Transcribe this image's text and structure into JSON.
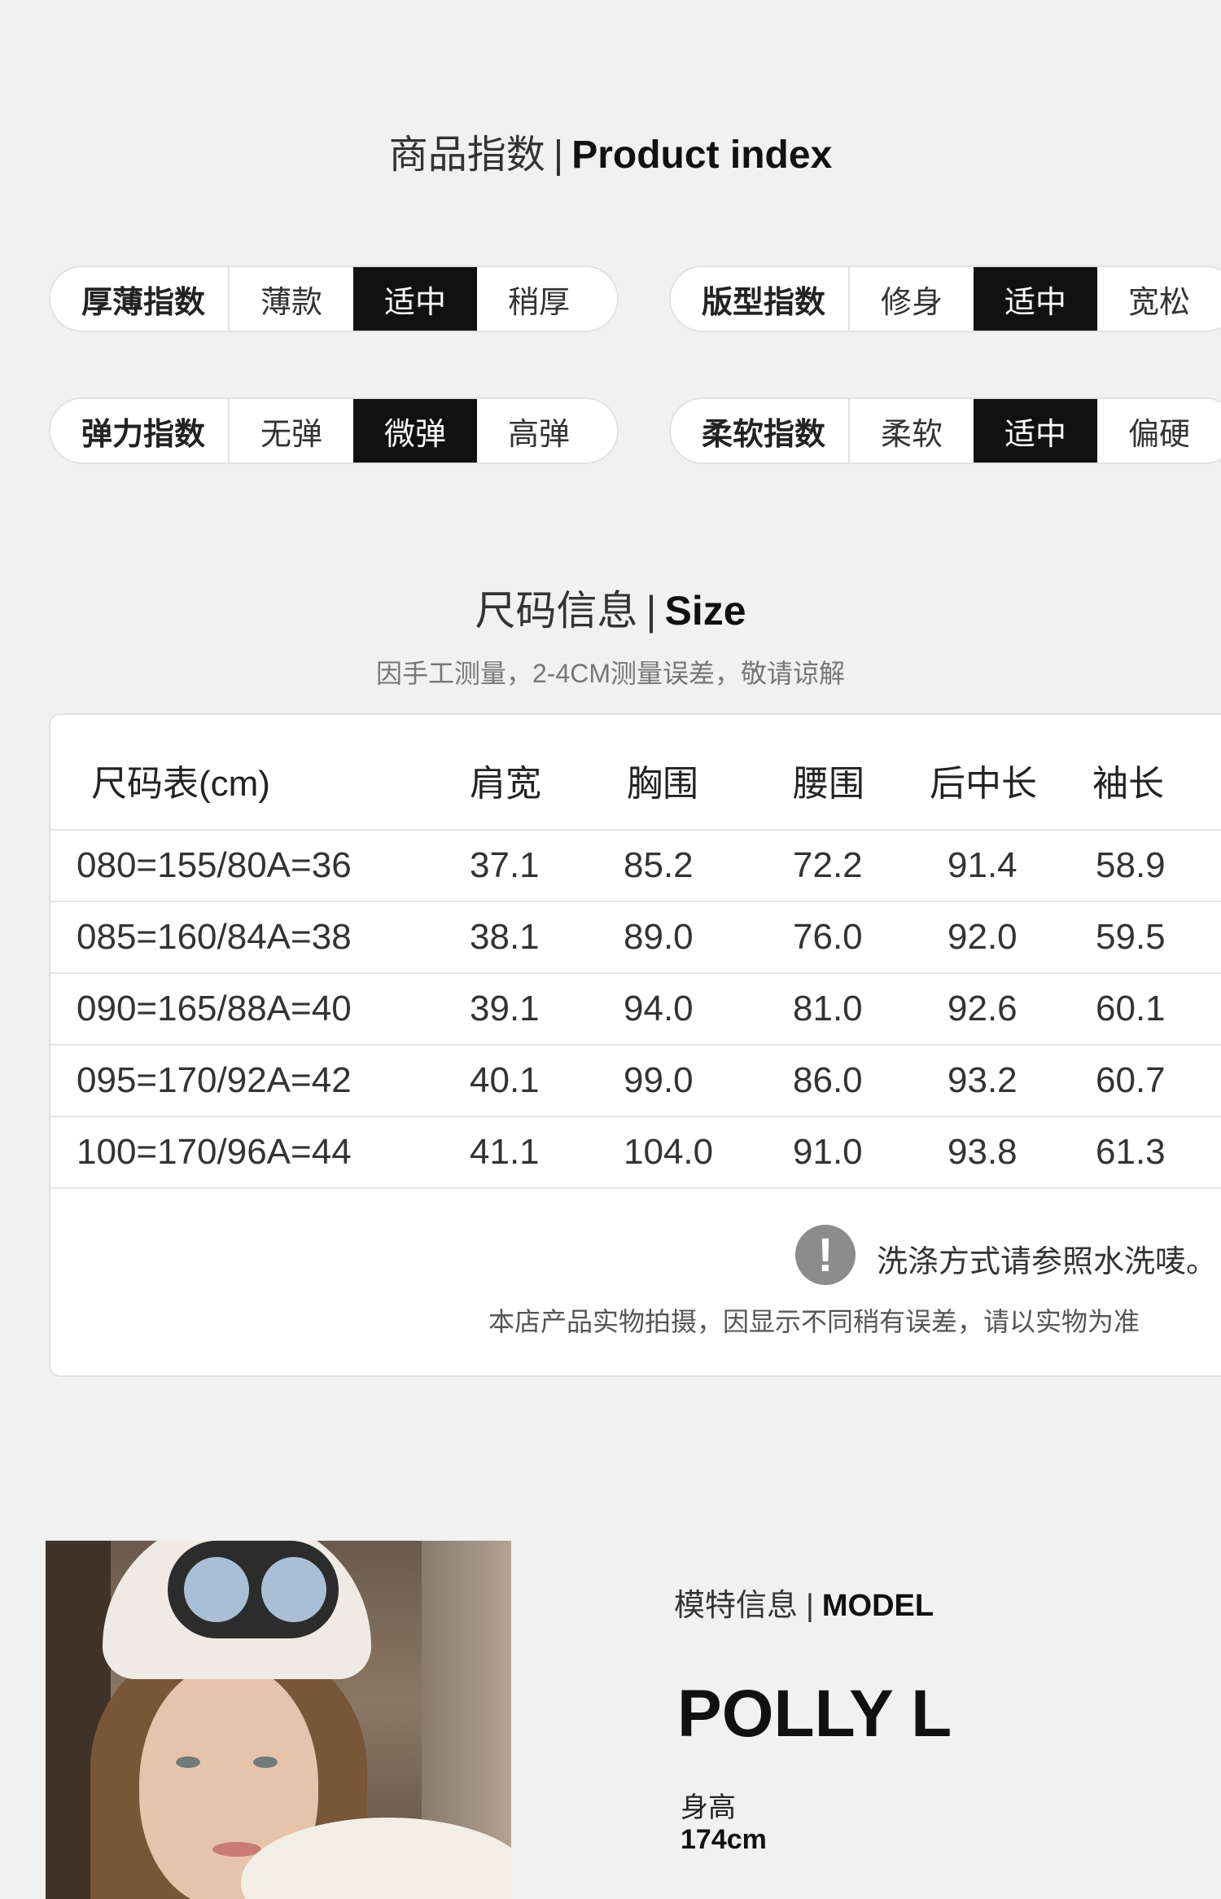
{
  "product_index": {
    "title_cn": "商品指数",
    "separator": "|",
    "title_en": "Product index",
    "indices": [
      {
        "label": "厚薄指数",
        "options": [
          "薄款",
          "适中",
          "稍厚"
        ],
        "selected": 1
      },
      {
        "label": "版型指数",
        "options": [
          "修身",
          "适中",
          "宽松"
        ],
        "selected": 1
      },
      {
        "label": "弹力指数",
        "options": [
          "无弹",
          "微弹",
          "高弹"
        ],
        "selected": 1
      },
      {
        "label": "柔软指数",
        "options": [
          "柔软",
          "适中",
          "偏硬"
        ],
        "selected": 1
      }
    ]
  },
  "size_info": {
    "title_cn": "尺码信息",
    "separator": "|",
    "title_en": "Size",
    "subtitle": "因手工测量，2-4CM测量误差，敬请谅解",
    "table": {
      "headers": [
        "尺码表(cm)",
        "肩宽",
        "胸围",
        "腰围",
        "后中长",
        "袖长"
      ],
      "rows": [
        [
          "080=155/80A=36",
          "37.1",
          "85.2",
          "72.2",
          "91.4",
          "58.9"
        ],
        [
          "085=160/84A=38",
          "38.1",
          "89.0",
          "76.0",
          "92.0",
          "59.5"
        ],
        [
          "090=165/88A=40",
          "39.1",
          "94.0",
          "81.0",
          "92.6",
          "60.1"
        ],
        [
          "095=170/92A=42",
          "40.1",
          "99.0",
          "86.0",
          "93.2",
          "60.7"
        ],
        [
          "100=170/96A=44",
          "41.1",
          "104.0",
          "91.0",
          "93.8",
          "61.3"
        ]
      ]
    },
    "note_icon": "exclamation-icon",
    "note_main": "洗涤方式请参照水洗唛。",
    "note_sub": "本店产品实物拍摄，因显示不同稍有误差，请以实物为准"
  },
  "model": {
    "title_cn": "模特信息",
    "separator": "|",
    "title_en": "MODEL",
    "name": "POLLY L",
    "height_label": "身高",
    "height_value": "174cm"
  }
}
